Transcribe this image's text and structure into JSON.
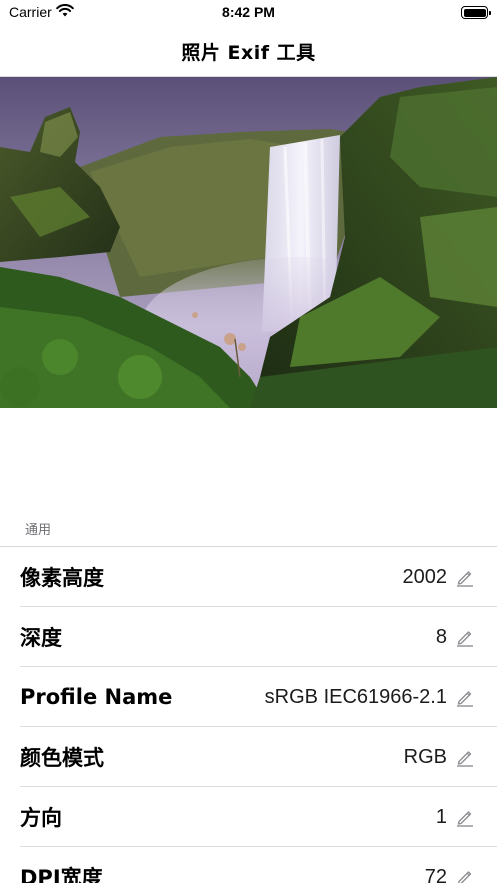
{
  "status_bar": {
    "carrier": "Carrier",
    "time": "8:42 PM",
    "wifi_icon": "wifi-icon",
    "battery_icon": "battery-icon"
  },
  "nav": {
    "title": "照片 Exif 工具"
  },
  "photo": {
    "description_icon": "photo-image"
  },
  "section": {
    "header": "通用"
  },
  "rows": [
    {
      "label": "像素高度",
      "value": "2002",
      "icon": "pencil-icon"
    },
    {
      "label": "深度",
      "value": "8",
      "icon": "pencil-icon"
    },
    {
      "label": "Profile Name",
      "value": "sRGB IEC61966-2.1",
      "icon": "pencil-icon"
    },
    {
      "label": "颜色模式",
      "value": "RGB",
      "icon": "pencil-icon"
    },
    {
      "label": "方向",
      "value": "1",
      "icon": "pencil-icon"
    },
    {
      "label": "DPI宽度",
      "value": "72",
      "icon": "pencil-icon"
    }
  ],
  "colors": {
    "separator": "#dcdcdc",
    "section_header": "#6d6d72",
    "icon": "#8e8e93"
  }
}
